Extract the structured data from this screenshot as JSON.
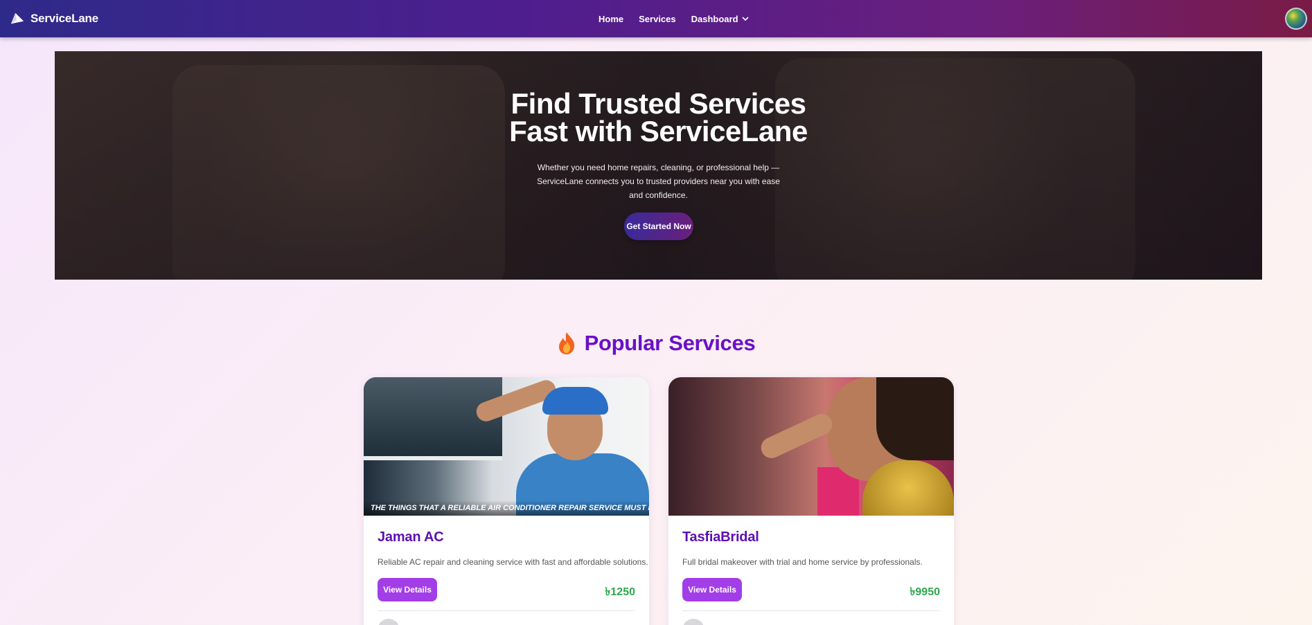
{
  "navbar": {
    "brand_name": "ServiceLane",
    "links": [
      {
        "label": "Home"
      },
      {
        "label": "Services"
      },
      {
        "label": "Dashboard"
      }
    ]
  },
  "hero": {
    "title_line1": "Find Trusted Services",
    "title_line2": "Fast with ServiceLane",
    "subtitle": "Whether you need home repairs, cleaning, or professional help — ServiceLane connects you to trusted providers near you with ease and confidence.",
    "cta_label": "Get Started Now"
  },
  "popular": {
    "title": "Popular Services",
    "cards": [
      {
        "name": "Jaman AC",
        "image_caption": "THE THINGS THAT A RELIABLE AIR CONDITIONER REPAIR SERVICE MUST PROVIDE",
        "description": "Reliable AC repair and cleaning service with fast and affordable solutions.",
        "button_label": "View Details",
        "price": "৳1250"
      },
      {
        "name": "TasfiaBridal",
        "description": "Full bridal makeover with trial and home service by professionals.",
        "button_label": "View Details",
        "price": "৳9950"
      }
    ]
  },
  "colors": {
    "brand_purple": "#6a10c8",
    "button_purple": "#a23ee8",
    "price_green": "#2ea84e"
  },
  "icons": {
    "brand": "paper-plane-icon",
    "dropdown": "chevron-down-icon",
    "section": "flame-icon"
  }
}
